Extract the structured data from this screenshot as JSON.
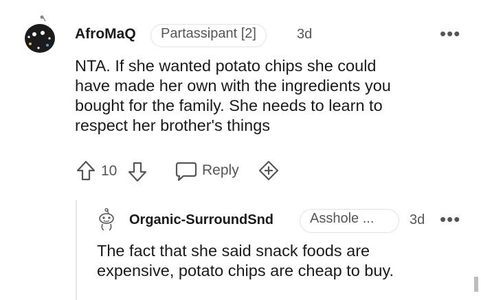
{
  "colors": {
    "text": "#1a1a1b",
    "muted": "#555555",
    "border": "#e2e2e2",
    "background": "#ffffff"
  },
  "comment": {
    "avatar_icon": "reddit-snoo-avatar-dark",
    "username": "AfroMaQ",
    "flair": "Partassipant [2]",
    "time": "3d",
    "more_label": "•••",
    "body_lines": [
      "NTA. If she wanted potato chips she could",
      "have made her own with the ingredients you",
      "bought for the family. She needs to learn to",
      "respect her brother's things"
    ],
    "score": "10",
    "reply_label": "Reply",
    "upvote_icon": "upvote-arrow-icon",
    "downvote_icon": "downvote-arrow-icon",
    "reply_icon": "speech-bubble-icon",
    "award_icon": "plus-award-icon"
  },
  "reply": {
    "avatar_icon": "reddit-snoo-avatar-outline",
    "username": "Organic-SurroundSnd",
    "flair": "Asshole ...",
    "time": "3d",
    "more_label": "•••",
    "body_lines": [
      "The fact that she said snack foods are",
      "expensive, potato chips are cheap to buy."
    ]
  }
}
